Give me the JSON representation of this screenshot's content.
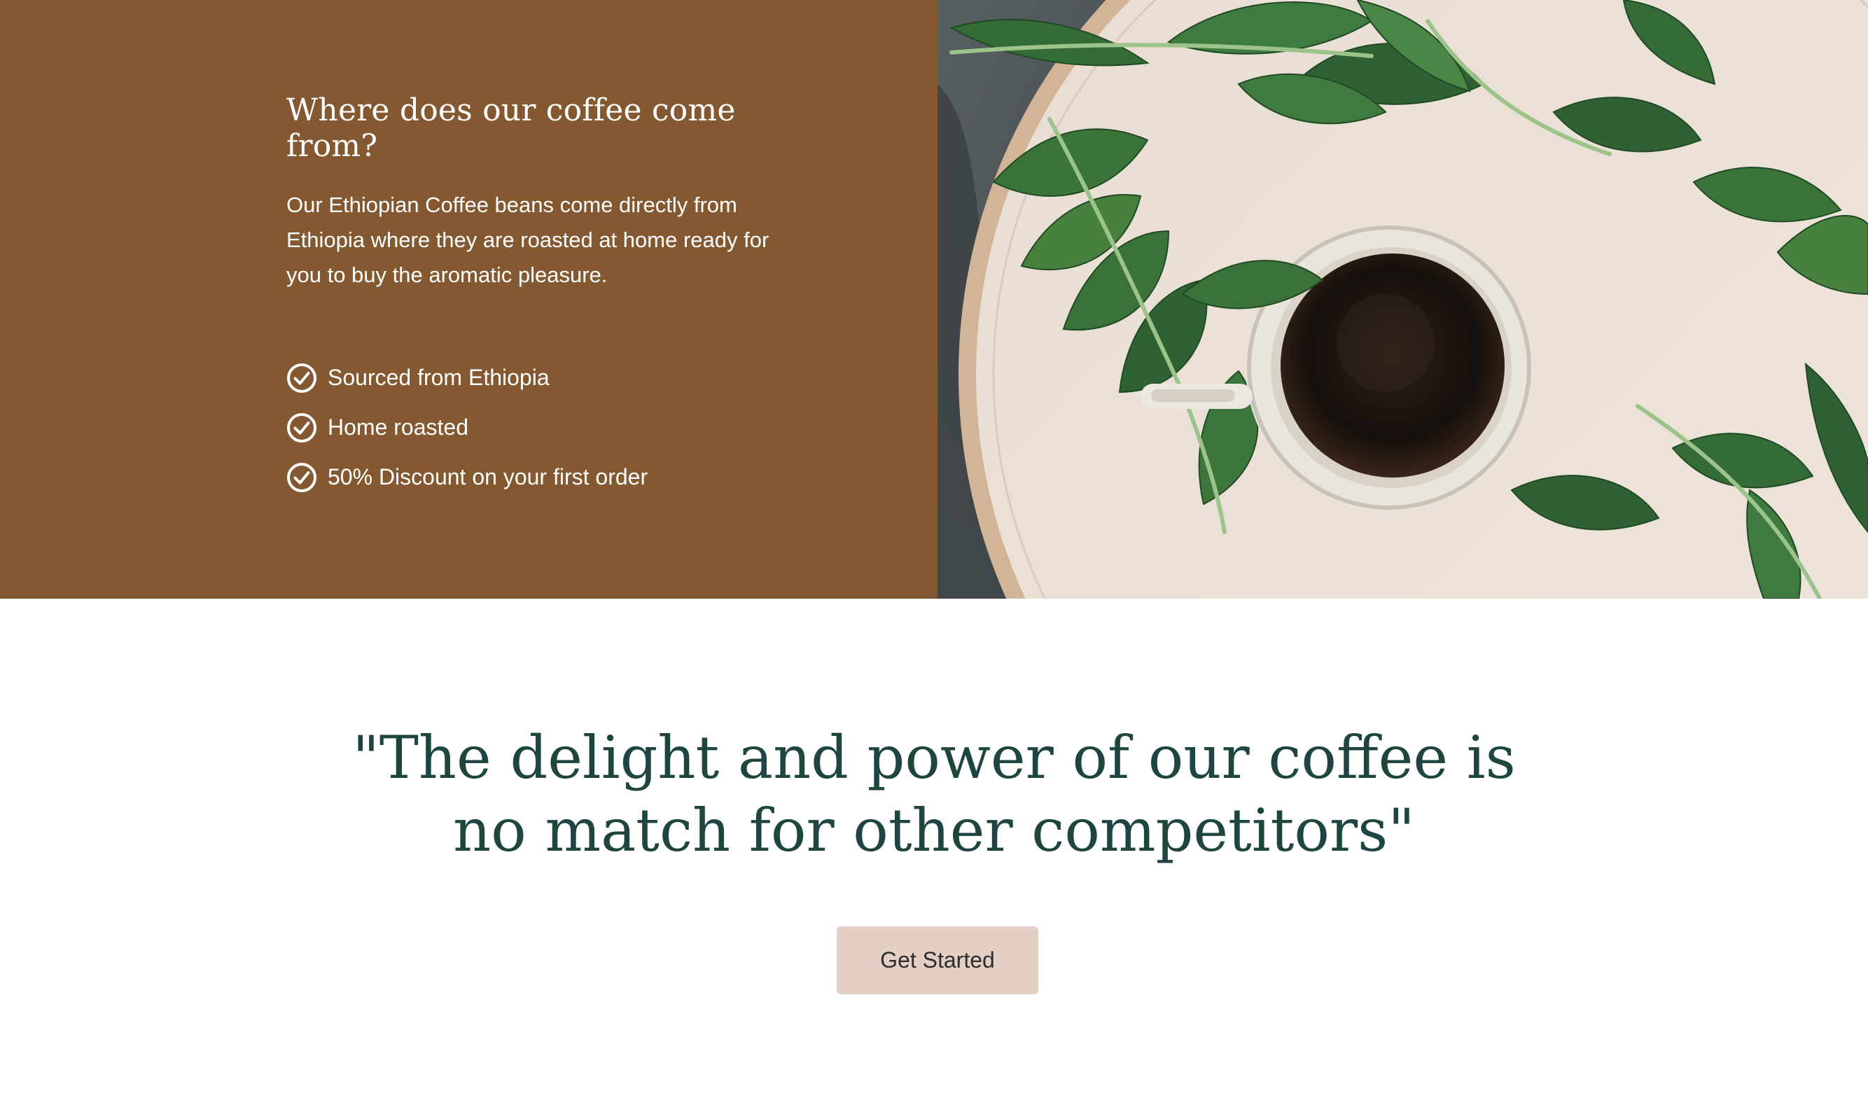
{
  "about": {
    "title": "Where does our coffee come from?",
    "description": "Our Ethiopian Coffee beans come directly from Ethiopia where they are roasted at home ready for you to buy the aromatic pleasure.",
    "features": [
      {
        "label": "Sourced from Ethiopia",
        "icon": "check-circle-icon"
      },
      {
        "label": "Home roasted",
        "icon": "check-circle-icon"
      },
      {
        "label": "50% Discount on your first order",
        "icon": "check-circle-icon"
      }
    ]
  },
  "testimonial": {
    "quote_line1": "\"The delight and power of our coffee is",
    "quote_line2": "no match for other competitors\""
  },
  "cta": {
    "label": "Get Started"
  },
  "colors": {
    "panel_brown": "#845830",
    "quote_green": "#1f4541",
    "button_bg": "#e4cfc4"
  }
}
